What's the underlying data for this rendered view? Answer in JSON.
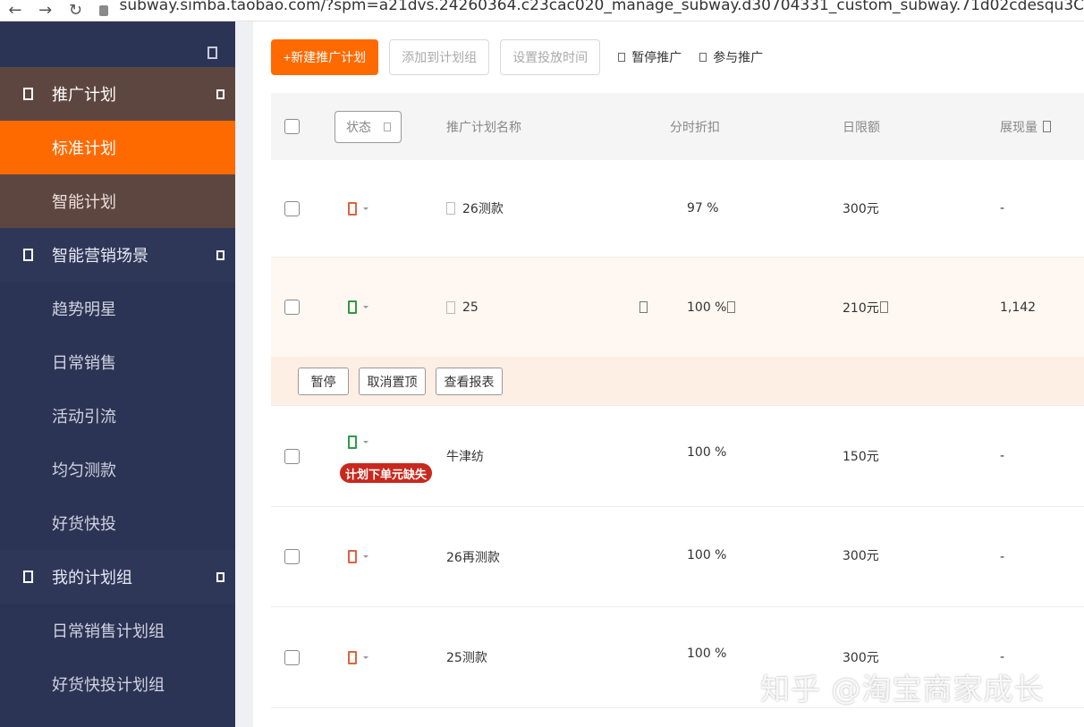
{
  "browser": {
    "back_glyph": "←",
    "forward_glyph": "→",
    "reload_glyph": "↻",
    "url": "subway.simba.taobao.com/?spm=a21dvs.24260364.c23cac020_manage_subway.d30704331_custom_subway.71d02cdesqu3C"
  },
  "sidebar": {
    "groups": [
      {
        "label": "推广计划",
        "items": [
          {
            "label": "标准计划"
          },
          {
            "label": "智能计划"
          }
        ]
      },
      {
        "label": "智能营销场景",
        "items": [
          {
            "label": "趋势明星"
          },
          {
            "label": "日常销售"
          },
          {
            "label": "活动引流"
          },
          {
            "label": "均匀测款"
          },
          {
            "label": "好货快投"
          }
        ]
      },
      {
        "label": "我的计划组",
        "items": [
          {
            "label": "日常销售计划组"
          },
          {
            "label": "好货快投计划组"
          }
        ]
      }
    ]
  },
  "toolbar": {
    "new_plan": "+新建推广计划",
    "add_to_group": "添加到计划组",
    "set_time": "设置投放时间",
    "pause": "暂停推广",
    "join": "参与推广"
  },
  "table": {
    "headers": {
      "status": "状态",
      "name": "推广计划名称",
      "discount": "分时折扣",
      "daily_limit": "日限额",
      "impressions": "展现量"
    },
    "rows": [
      {
        "status_color": "#e0623c",
        "name": "26测款",
        "discount": "97 %",
        "daily_limit": "300元",
        "impressions": "-"
      },
      {
        "status_color": "#2e9a4a",
        "name": "25",
        "discount": "100 %",
        "daily_limit": "210元",
        "impressions": "1,142"
      },
      {
        "status_color": "#2e9a4a",
        "name": "牛津纺",
        "badge": "计划下单元缺失",
        "discount": "100 %",
        "daily_limit": "150元",
        "impressions": "-"
      },
      {
        "status_color": "#e0623c",
        "name": "26再测款",
        "discount": "100 %",
        "daily_limit": "300元",
        "impressions": "-"
      },
      {
        "status_color": "#e0623c",
        "name": "25测款",
        "discount": "100 %",
        "daily_limit": "300元",
        "impressions": "-"
      }
    ],
    "row_actions": {
      "pause": "暂停",
      "unpin": "取消置顶",
      "report": "查看报表"
    }
  },
  "watermark": "知乎 @淘宝商家成长",
  "colors": {
    "accent": "#ff6a00",
    "sidebar_bg": "#2c3455",
    "sidebar_open": "#5e4640",
    "badge": "#c8281d"
  }
}
